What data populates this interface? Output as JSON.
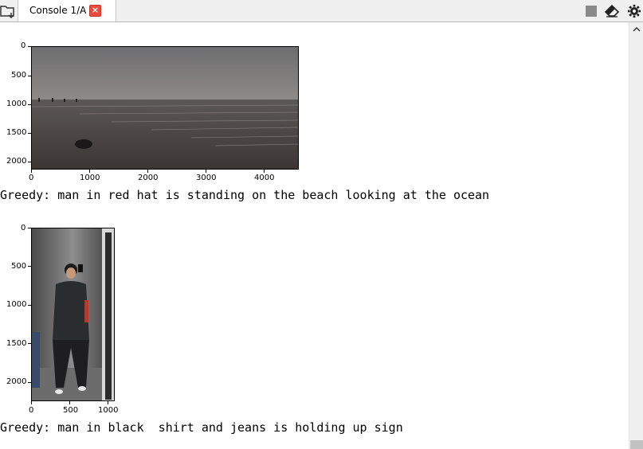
{
  "tab": {
    "label": "Console 1/A",
    "close_icon": "close-icon"
  },
  "toolbar": {
    "icons": [
      "stop-icon",
      "eraser-icon",
      "gear-icon"
    ]
  },
  "outputs": [
    {
      "image_desc": "beach-scene",
      "y_ticks": [
        "0",
        "500",
        "1000",
        "1500",
        "2000"
      ],
      "x_ticks": [
        "0",
        "1000",
        "2000",
        "3000",
        "4000"
      ],
      "caption": "Greedy: man in red hat is standing on the beach looking at the ocean"
    },
    {
      "image_desc": "elevator-selfie",
      "y_ticks": [
        "0",
        "500",
        "1000",
        "1500",
        "2000"
      ],
      "x_ticks": [
        "0",
        "500",
        "1000"
      ],
      "caption": "Greedy: man in black  shirt and jeans is holding up sign"
    }
  ]
}
